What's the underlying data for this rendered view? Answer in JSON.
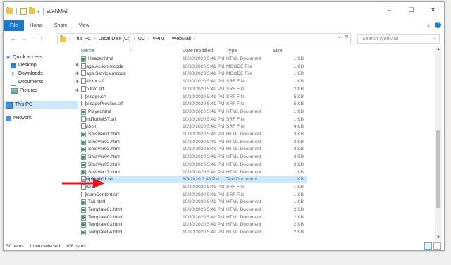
{
  "window": {
    "title": "WebMail",
    "controls": [
      "–",
      "☐",
      "✕"
    ]
  },
  "ribbon": {
    "tabs": [
      "File",
      "Home",
      "Share",
      "View"
    ],
    "expand": "⌄",
    "help": "?"
  },
  "nav": {
    "back": "←",
    "forward": "→",
    "down": "⌄",
    "up": "↑"
  },
  "address": {
    "crumbs": [
      "This PC",
      "Local Disk (C:)",
      "UC",
      "VPIM",
      "WebMail"
    ],
    "separator": "›",
    "dropdown": "⌄",
    "refresh": "↻",
    "search_placeholder": "Search WebMail",
    "search_icon": "⌕"
  },
  "sidebar": {
    "items": [
      {
        "label": "Quick access",
        "icon": "star-icon"
      },
      {
        "label": "Desktop",
        "icon": "desktop-icon",
        "pinned": true
      },
      {
        "label": "Downloads",
        "icon": "download-icon",
        "pinned": true
      },
      {
        "label": "Documents",
        "icon": "documents-icon",
        "pinned": true
      },
      {
        "label": "Pictures",
        "icon": "pictures-icon",
        "pinned": true
      },
      {
        "label": "This PC",
        "icon": "computer-icon"
      },
      {
        "label": "Network",
        "icon": "network-icon"
      }
    ],
    "pin_glyph": "✱"
  },
  "columns": {
    "name": "Name",
    "date": "Date modified",
    "type": "Type",
    "size": "Size",
    "sort_glyph": "^"
  },
  "files": [
    {
      "name": "Header.html",
      "date": "10/30/2020 5:41 PM",
      "type": "HTML Document",
      "size": "1 KB",
      "icon": "html"
    },
    {
      "name": "Image.Action.mcode",
      "date": "10/30/2020 5:41 PM",
      "type": "MCODE File",
      "size": "1 KB",
      "icon": "doc"
    },
    {
      "name": "Image.Service.mcode",
      "date": "10/30/2020 5:41 PM",
      "type": "MCODE File",
      "size": "1 KB",
      "icon": "doc"
    },
    {
      "name": "Mailbox.srf",
      "date": "10/30/2020 5:41 PM",
      "type": "SRF File",
      "size": "1 KB",
      "icon": "doc"
    },
    {
      "name": "MbxInfo.srf",
      "date": "10/30/2020 5:41 PM",
      "type": "SRF File",
      "size": "2 KB",
      "icon": "doc"
    },
    {
      "name": "Message.srf",
      "date": "10/30/2020 5:41 PM",
      "type": "SRF File",
      "size": "5 KB",
      "icon": "doc"
    },
    {
      "name": "MessagePreview.srf",
      "date": "10/30/2020 5:41 PM",
      "type": "SRF File",
      "size": "5 KB",
      "icon": "doc"
    },
    {
      "name": "Player.html",
      "date": "10/30/2020 5:41 PM",
      "type": "HTML Document",
      "size": "1 KB",
      "icon": "html"
    },
    {
      "name": "SendToUMST.srf",
      "date": "10/30/2020 5:41 PM",
      "type": "SRF File",
      "size": "1 KB",
      "icon": "doc"
    },
    {
      "name": "SMS.srf",
      "date": "10/30/2020 5:41 PM",
      "type": "SRF File",
      "size": "4 KB",
      "icon": "doc"
    },
    {
      "name": "SmsVer01.html",
      "date": "10/30/2020 5:41 PM",
      "type": "HTML Document",
      "size": "3 KB",
      "icon": "html"
    },
    {
      "name": "SmsVer02.html",
      "date": "10/30/2020 5:41 PM",
      "type": "HTML Document",
      "size": "3 KB",
      "icon": "html"
    },
    {
      "name": "SmsVer03.html",
      "date": "10/30/2020 5:41 PM",
      "type": "HTML Document",
      "size": "3 KB",
      "icon": "html"
    },
    {
      "name": "SmsVer04.html",
      "date": "10/30/2020 5:41 PM",
      "type": "HTML Document",
      "size": "3 KB",
      "icon": "html"
    },
    {
      "name": "SmsVer05.html",
      "date": "10/30/2020 5:41 PM",
      "type": "HTML Document",
      "size": "3 KB",
      "icon": "html"
    },
    {
      "name": "SmsVer17.html",
      "date": "10/30/2020 5:41 PM",
      "type": "HTML Document",
      "size": "1 KB",
      "icon": "html"
    },
    {
      "name": "SmtpNotif01.txt",
      "date": "6/8/2020 3:48 PM",
      "type": "Text Document",
      "size": "1 KB",
      "icon": "txt",
      "selected": true
    },
    {
      "name": "SSO.srf",
      "date": "10/30/2020 5:41 PM",
      "type": "SRF File",
      "size": "1 KB",
      "icon": "doc"
    },
    {
      "name": "StreamContent.srf",
      "date": "10/30/2020 5:41 PM",
      "type": "SRF File",
      "size": "1 KB",
      "icon": "doc"
    },
    {
      "name": "Tail.html",
      "date": "10/30/2020 5:41 PM",
      "type": "HTML Document",
      "size": "1 KB",
      "icon": "html"
    },
    {
      "name": "Template01.html",
      "date": "10/30/2020 5:41 PM",
      "type": "HTML Document",
      "size": "2 KB",
      "icon": "html"
    },
    {
      "name": "Template02.html",
      "date": "10/30/2020 5:41 PM",
      "type": "HTML Document",
      "size": "2 KB",
      "icon": "html"
    },
    {
      "name": "Template03.html",
      "date": "10/30/2020 5:41 PM",
      "type": "HTML Document",
      "size": "2 KB",
      "icon": "html"
    },
    {
      "name": "Template04.html",
      "date": "10/30/2020 5:41 PM",
      "type": "HTML Document",
      "size": "2 KB",
      "icon": "html"
    }
  ],
  "status": {
    "items": "50 items",
    "selected": "1 item selected",
    "size": "106 bytes"
  },
  "colors": {
    "accent": "#1979ca",
    "selection": "#cce8ff",
    "arrow": "#e3141a"
  }
}
